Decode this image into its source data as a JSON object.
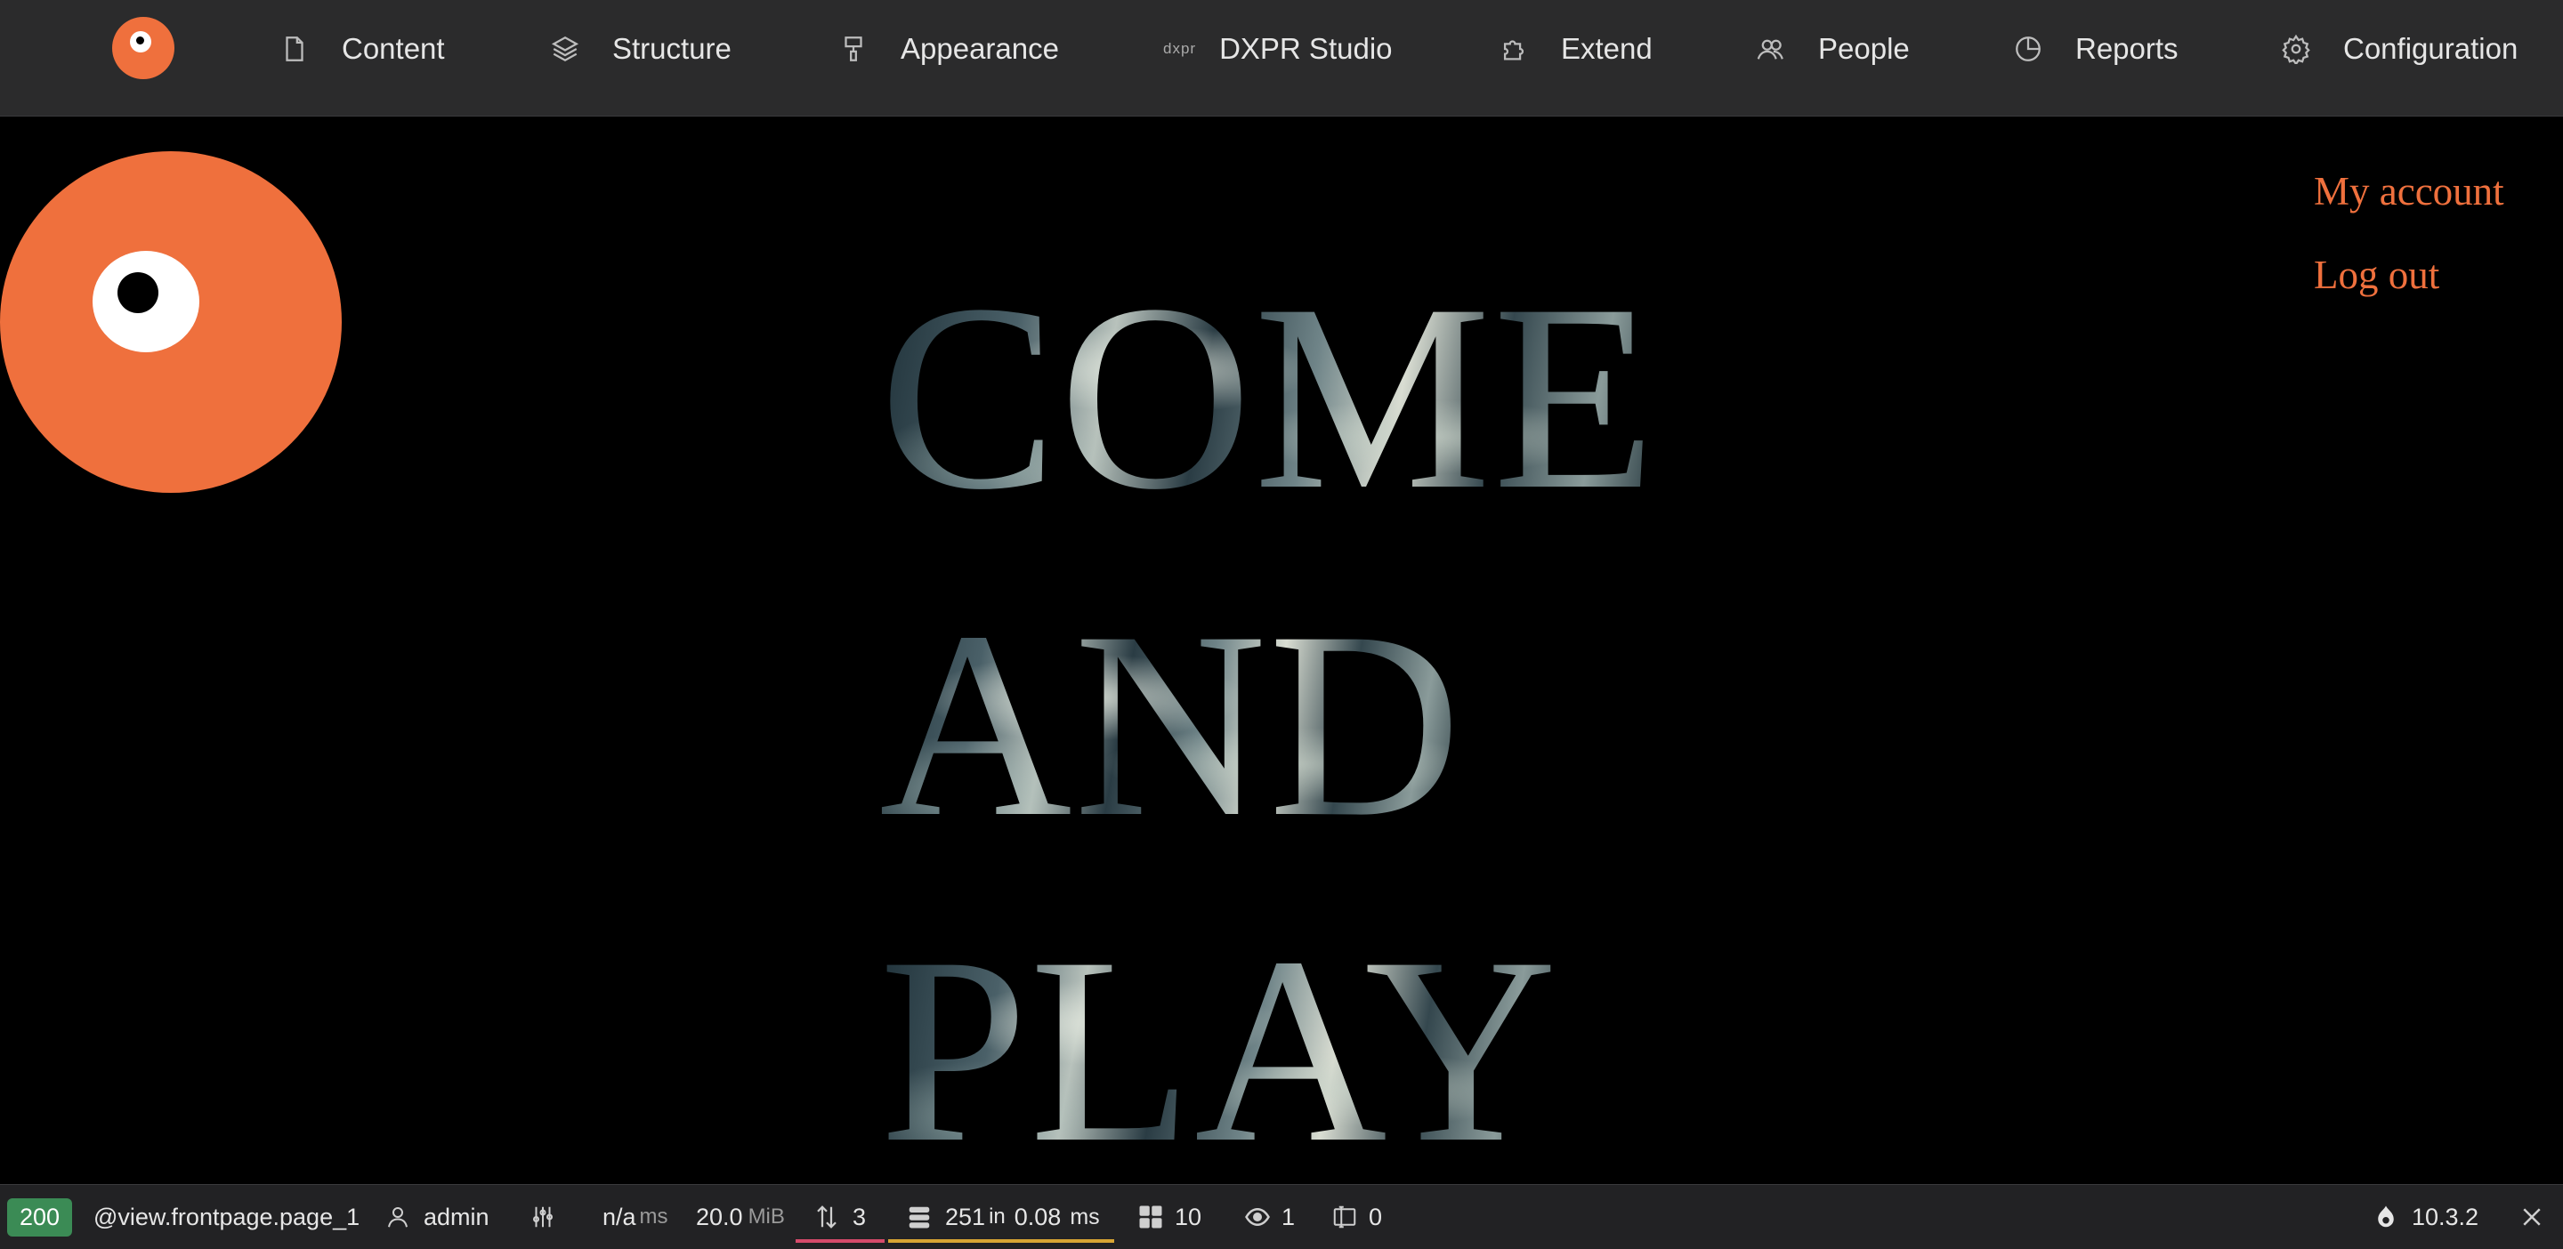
{
  "toolbar": {
    "items": [
      {
        "label": "Content",
        "icon": "file-icon"
      },
      {
        "label": "Structure",
        "icon": "layers-icon"
      },
      {
        "label": "Appearance",
        "icon": "paintbrush-icon"
      },
      {
        "label": "DXPR Studio",
        "icon": "dxpr-icon",
        "icon_text": "dxpr"
      },
      {
        "label": "Extend",
        "icon": "puzzle-icon"
      },
      {
        "label": "People",
        "icon": "people-icon"
      },
      {
        "label": "Reports",
        "icon": "pie-chart-icon"
      },
      {
        "label": "Configuration",
        "icon": "gear-icon"
      }
    ]
  },
  "account_menu": {
    "my_account": "My account",
    "logout": "Log out"
  },
  "hero": {
    "line1": "COME",
    "line2": "AND",
    "line3": "PLAY"
  },
  "profiler": {
    "status_code": "200",
    "route": "@view.frontpage.page_1",
    "user": "admin",
    "time_value": "n/a",
    "time_unit": "ms",
    "memory_value": "20.0",
    "memory_unit": "MiB",
    "requests_count": "3",
    "db_queries": "251",
    "db_in": "in",
    "db_time": "0.08",
    "db_unit": "ms",
    "blocks_count": "10",
    "views_count": "1",
    "forms_count": "0",
    "drupal_version": "10.3.2",
    "colors": {
      "status_ok": "#3b8b55",
      "requests_bar": "#d64b6b",
      "db_bar": "#d8a534"
    }
  },
  "colors": {
    "brand_orange": "#ef703d",
    "toolbar_bg": "#2b2b2c",
    "page_bg": "#000000"
  }
}
